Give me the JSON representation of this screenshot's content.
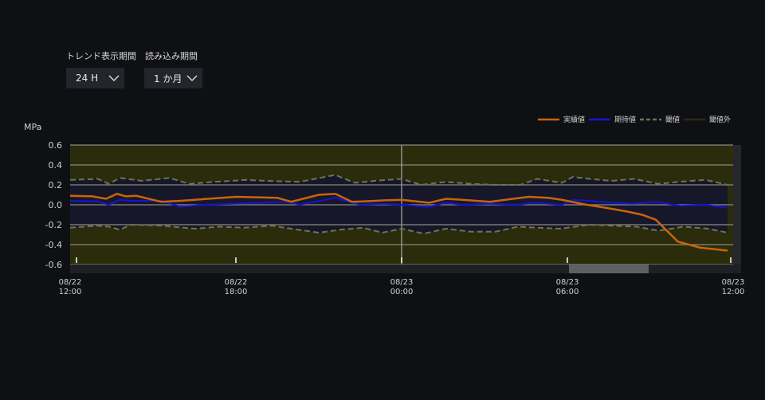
{
  "controls": {
    "trend_period": {
      "label": "トレンド表示期間",
      "value": "24 H"
    },
    "load_period": {
      "label": "読み込み期間",
      "value": "1 か月"
    }
  },
  "chart_data": {
    "type": "line",
    "ylabel": "MPa",
    "ylim": [
      -0.6,
      0.6
    ],
    "yticks": [
      "0.6",
      "0.4",
      "0.2",
      "0.0",
      "-0.2",
      "-0.4",
      "-0.6"
    ],
    "xlim_hours": [
      0,
      24
    ],
    "xticks": [
      {
        "hour": 0,
        "date": "08/22",
        "time": "12:00"
      },
      {
        "hour": 6,
        "date": "08/22",
        "time": "18:00"
      },
      {
        "hour": 12,
        "date": "08/23",
        "time": "00:00"
      },
      {
        "hour": 18,
        "date": "08/23",
        "time": "06:00"
      },
      {
        "hour": 24,
        "date": "08/23",
        "time": "12:00"
      }
    ],
    "cursor_hour": 12,
    "grid": true,
    "legend_position": "top-right",
    "colors": {
      "actual": "#c8660a",
      "expected": "#1414d8",
      "threshold": "#6e7358",
      "outside": "#2b2c0b",
      "inside": "#17172a"
    },
    "series": [
      {
        "name": "実績値",
        "key": "actual",
        "x": [
          0,
          0.8,
          1.3,
          1.7,
          2,
          2.4,
          3.3,
          4,
          6,
          7.5,
          8,
          9,
          9.6,
          10.2,
          10.7,
          11.4,
          12,
          13,
          13.6,
          14.2,
          15.2,
          16.6,
          17.3,
          17.8,
          18.7,
          19.6,
          20.2,
          20.7,
          21.2,
          22,
          22.8,
          23.8
        ],
        "y": [
          0.09,
          0.085,
          0.06,
          0.11,
          0.085,
          0.09,
          0.03,
          0.04,
          0.08,
          0.07,
          0.03,
          0.1,
          0.11,
          0.03,
          0.035,
          0.045,
          0.05,
          0.02,
          0.06,
          0.05,
          0.03,
          0.08,
          0.07,
          0.05,
          0.0,
          -0.04,
          -0.07,
          -0.1,
          -0.15,
          -0.37,
          -0.43,
          -0.46
        ]
      },
      {
        "name": "期待値",
        "key": "expected",
        "x": [
          0,
          1,
          1.4,
          1.8,
          2.2,
          3.3,
          4,
          4.8,
          5.9,
          6.9,
          7.9,
          8.3,
          9.6,
          10.5,
          11.3,
          12,
          13,
          13.6,
          14.2,
          15.2,
          16.2,
          16.8,
          17.8,
          18.2,
          18.8,
          19.6,
          20.4,
          21.2,
          22.1,
          23,
          23.8
        ],
        "y": [
          0.04,
          0.035,
          0.0,
          0.05,
          0.04,
          0.04,
          -0.02,
          0.0,
          0.01,
          0.02,
          0.03,
          0.0,
          0.07,
          0.0,
          0.01,
          0.0,
          -0.02,
          0.02,
          0.0,
          0.01,
          0.0,
          0.02,
          0.0,
          0.05,
          0.04,
          0.02,
          0.01,
          0.03,
          -0.01,
          0.0,
          -0.03
        ]
      },
      {
        "name": "閾値",
        "key": "threshold",
        "upper": {
          "x": [
            0,
            1,
            1.4,
            1.8,
            2.6,
            3.6,
            4.3,
            5.2,
            6.4,
            7.1,
            8.3,
            9.6,
            10.3,
            11,
            12,
            12.7,
            13.6,
            14.5,
            15.4,
            16.3,
            16.9,
            17.8,
            18.2,
            18.8,
            19.6,
            20.4,
            21.3,
            22,
            23,
            23.8
          ],
          "y": [
            0.25,
            0.26,
            0.21,
            0.27,
            0.24,
            0.27,
            0.21,
            0.23,
            0.25,
            0.24,
            0.23,
            0.3,
            0.22,
            0.24,
            0.26,
            0.2,
            0.23,
            0.21,
            0.2,
            0.2,
            0.26,
            0.22,
            0.28,
            0.26,
            0.24,
            0.26,
            0.21,
            0.23,
            0.25,
            0.2
          ]
        },
        "lower": {
          "x": [
            0,
            1,
            1.4,
            1.8,
            2.2,
            3.3,
            4.5,
            5.4,
            6.3,
            7.3,
            8,
            9,
            9.8,
            10.6,
            11.3,
            12,
            12.8,
            13.6,
            14.5,
            15.4,
            16.2,
            16.9,
            17.7,
            18.3,
            18.8,
            19.6,
            20.5,
            21.3,
            22.2,
            23.1,
            23.8
          ],
          "y": [
            -0.23,
            -0.21,
            -0.22,
            -0.25,
            -0.2,
            -0.21,
            -0.24,
            -0.22,
            -0.23,
            -0.21,
            -0.24,
            -0.28,
            -0.25,
            -0.23,
            -0.28,
            -0.24,
            -0.29,
            -0.24,
            -0.27,
            -0.27,
            -0.22,
            -0.23,
            -0.24,
            -0.22,
            -0.2,
            -0.21,
            -0.22,
            -0.26,
            -0.22,
            -0.24,
            -0.28
          ]
        }
      },
      {
        "name": "閾値外",
        "key": "outside"
      }
    ]
  }
}
